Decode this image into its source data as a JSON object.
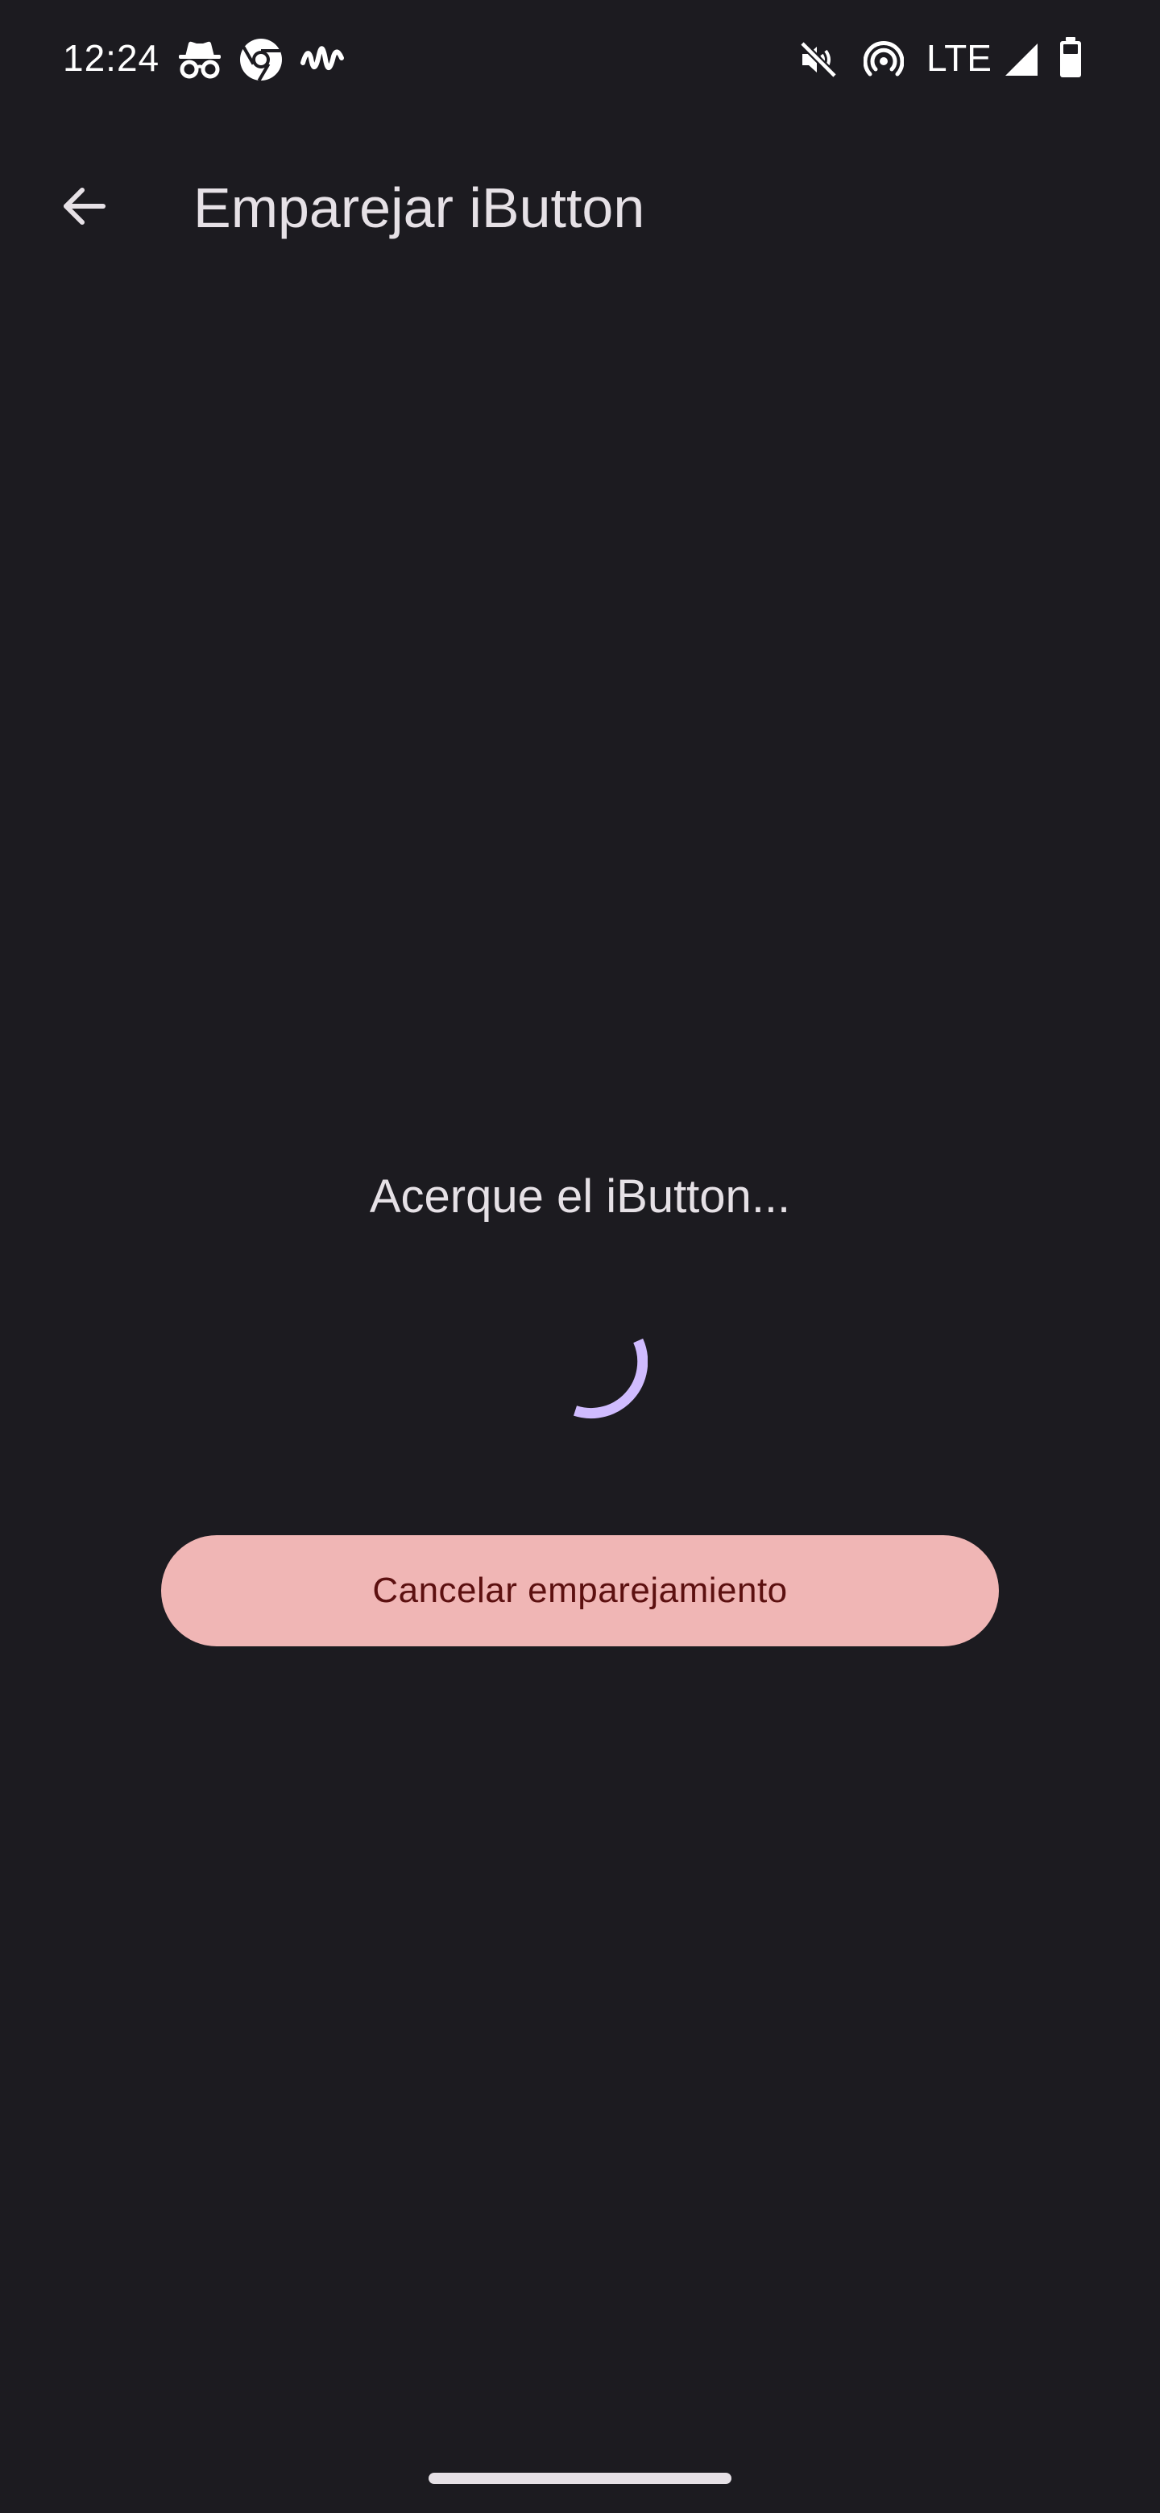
{
  "status_bar": {
    "time": "12:24",
    "network": "LTE",
    "left_icons": [
      "incognito-icon",
      "chrome-icon",
      "pulse-icon"
    ],
    "right_icons": [
      "mute-icon",
      "hotspot-icon",
      "signal-icon",
      "battery-icon"
    ]
  },
  "app_bar": {
    "back_icon": "arrow-back-icon",
    "title": "Emparejar iButton"
  },
  "main": {
    "prompt": "Acerque el iButton...",
    "cancel_label": "Cancelar emparejamiento"
  },
  "colors": {
    "background": "#1c1b20",
    "text_primary": "#e6e1e6",
    "spinner": "#d0bcff",
    "button_bg": "#f0b6b5",
    "button_text": "#5c1010"
  }
}
